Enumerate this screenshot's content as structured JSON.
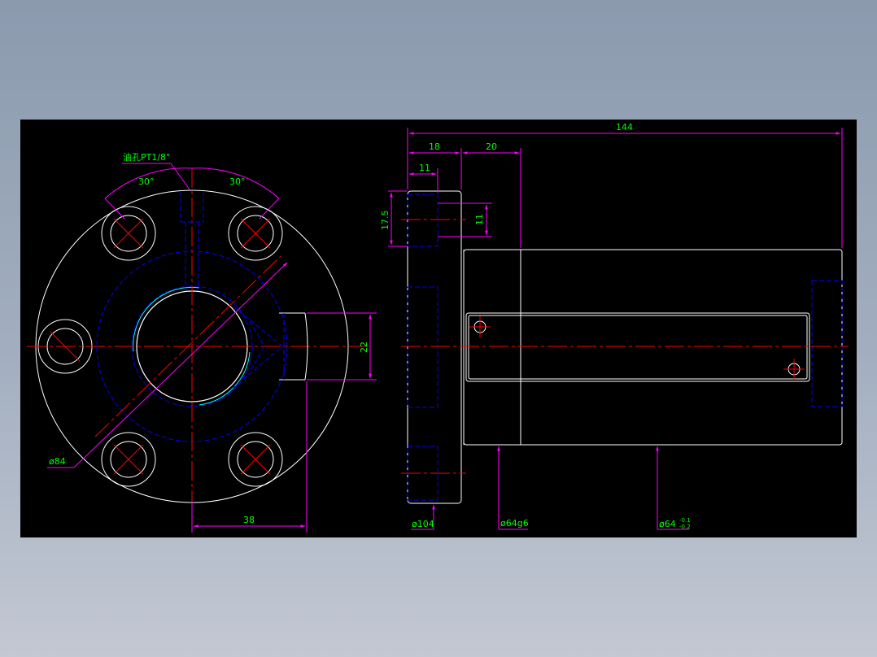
{
  "drawing": {
    "colors": {
      "background": "#000000",
      "outline": "#ffffff",
      "center_line": "#ff0000",
      "hidden_line": "#0000ff",
      "dimension": "#ff00ff",
      "text": "#00ff00",
      "thread": "#00ffff"
    },
    "front_view": {
      "oil_hole_label": "油孔PT1/8\"",
      "angle_left": "30°",
      "angle_right": "30°",
      "dim_22": "22",
      "dim_38": "38",
      "dia_84": "ø84"
    },
    "side_view": {
      "dim_144": "144",
      "dim_18": "18",
      "dim_20": "20",
      "dim_11_top": "11",
      "dim_17_5": "17.5",
      "dim_11_right": "11",
      "dia_104": "ø104",
      "dia_64g6": "ø64g6",
      "dia_64": "ø64",
      "tol_upper": "-0.1",
      "tol_lower": "-0.2"
    }
  }
}
